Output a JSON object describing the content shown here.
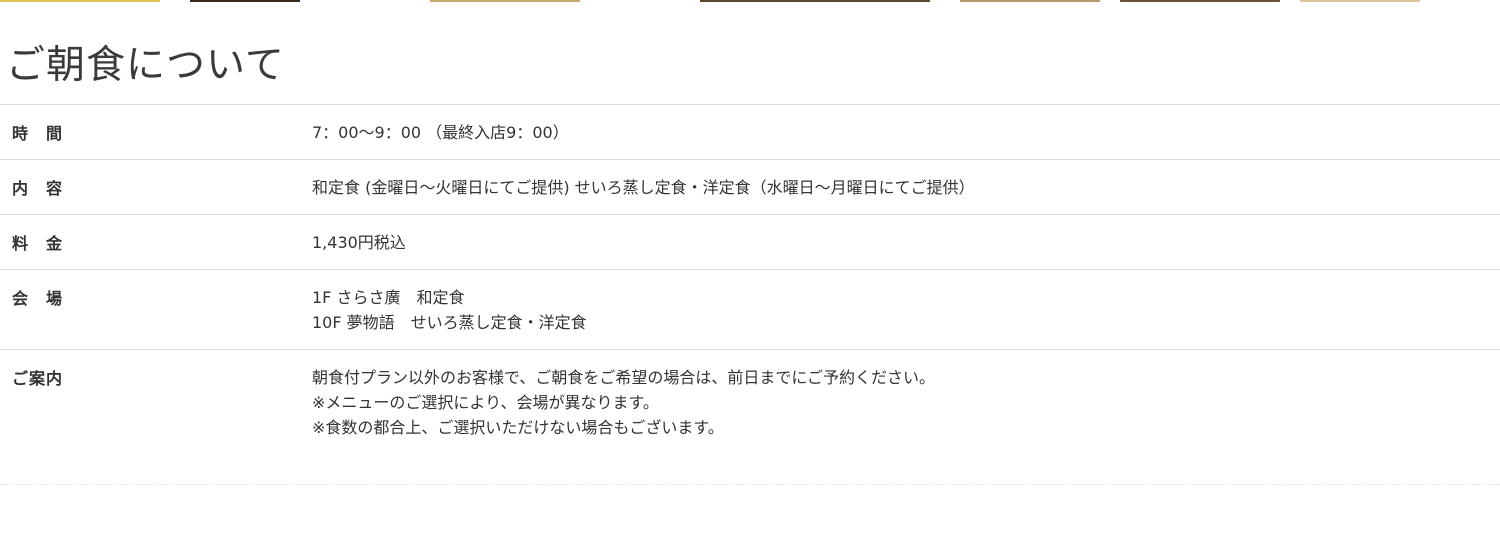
{
  "section": {
    "title": "ご朝食について"
  },
  "rows": [
    {
      "label": "時　間",
      "lines": [
        "7：00〜9：00 （最終入店9：00）"
      ]
    },
    {
      "label": "内　容",
      "lines": [
        "和定食 (金曜日〜火曜日にてご提供) せいろ蒸し定食・洋定食（水曜日〜月曜日にてご提供）"
      ]
    },
    {
      "label": "料　金",
      "lines": [
        "1,430円税込"
      ]
    },
    {
      "label": "会　場",
      "lines": [
        "1F さらさ廣　和定食",
        "10F 夢物語　せいろ蒸し定食・洋定食"
      ]
    },
    {
      "label": "ご案内",
      "lines": [
        "朝食付プラン以外のお客様で、ご朝食をご希望の場合は、前日までにご予約ください。",
        "※メニューのご選択により、会場が異なります。",
        "※食数の都合上、ご選択いただけない場合もございます。"
      ]
    }
  ]
}
